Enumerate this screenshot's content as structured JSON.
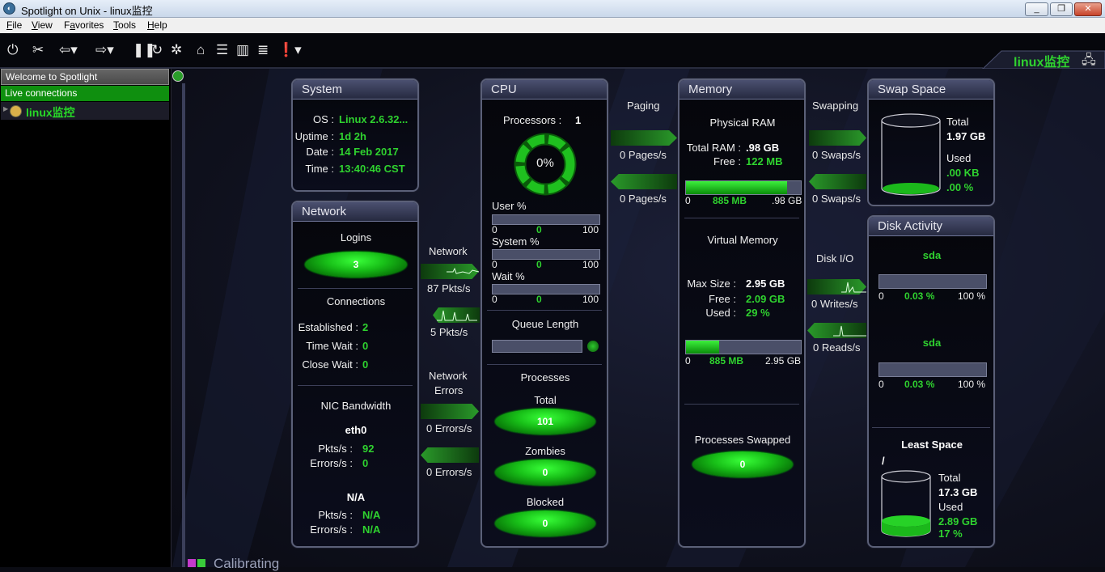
{
  "window": {
    "title": "Spotlight on Unix - linux监控",
    "min": "_",
    "max": "❐",
    "close": "✕"
  },
  "menu": [
    "File",
    "View",
    "Favorites",
    "Tools",
    "Help"
  ],
  "menu_access": [
    "F",
    "V",
    "a",
    "T",
    "H"
  ],
  "toolbar_icons": [
    "connect-icon",
    "disconnect-icon",
    "back-icon",
    "forward-icon",
    "pause-icon",
    "refresh-icon",
    "tools-icon",
    "home-icon",
    "list-icon",
    "chart-icon",
    "database-icon",
    "alarm-icon"
  ],
  "brand": {
    "connection_label": "linux监控"
  },
  "left": {
    "welcome": "Welcome to Spotlight",
    "live": "Live connections",
    "node": "linux监控"
  },
  "system": {
    "title": "System",
    "os_label": "OS :",
    "os": "Linux 2.6.32...",
    "uptime_label": "Uptime :",
    "uptime": "1d 2h",
    "date_label": "Date :",
    "date": "14 Feb 2017",
    "time_label": "Time :",
    "time": "13:40:46 CST"
  },
  "network": {
    "title": "Network",
    "logins_label": "Logins",
    "logins": "3",
    "connections_label": "Connections",
    "established_label": "Established :",
    "established": "2",
    "timewait_label": "Time  Wait :",
    "timewait": "0",
    "closewait_label": "Close  Wait :",
    "closewait": "0",
    "nic_label": "NIC Bandwidth",
    "nic1": {
      "name": "eth0",
      "pkts_label": "Pkts/s :",
      "pkts": "92",
      "errors_label": "Errors/s :",
      "errors": "0"
    },
    "nic2": {
      "name": "N/A",
      "pkts_label": "Pkts/s :",
      "pkts": "N/A",
      "errors_label": "Errors/s :",
      "errors": "N/A"
    }
  },
  "net_flow": {
    "label": "Network",
    "in": "87 Pkts/s",
    "out": "5 Pkts/s",
    "errors_label_1": "Network",
    "errors_label_2": "Errors",
    "err_in": "0 Errors/s",
    "err_out": "0 Errors/s"
  },
  "cpu": {
    "title": "CPU",
    "processors_label": "Processors :",
    "processors": "1",
    "usage": "0%",
    "usage_fraction": 0.0,
    "user_label": "User %",
    "user": "0",
    "user_min": "0",
    "user_max": "100",
    "system_label": "System %",
    "system": "0",
    "system_min": "0",
    "system_max": "100",
    "wait_label": "Wait %",
    "wait": "0",
    "wait_min": "0",
    "wait_max": "100",
    "queue_label": "Queue Length",
    "processes_label": "Processes",
    "total_label": "Total",
    "total": "101",
    "zombies_label": "Zombies",
    "zombies": "0",
    "blocked_label": "Blocked",
    "blocked": "0"
  },
  "paging": {
    "label": "Paging",
    "in": "0 Pages/s",
    "out": "0 Pages/s"
  },
  "memory": {
    "title": "Memory",
    "physical_label": "Physical RAM",
    "total_label": "Total RAM :",
    "total": ".98 GB",
    "free_label": "Free :",
    "free": "122 MB",
    "phys_used_fraction": 0.88,
    "phys_min": "0",
    "phys_used": "885 MB",
    "phys_max": ".98 GB",
    "virtual_label": "Virtual Memory",
    "max_label": "Max Size :",
    "max": "2.95 GB",
    "vfree_label": "Free :",
    "vfree": "2.09 GB",
    "used_label": "Used :",
    "used": "29 %",
    "virt_used_fraction": 0.29,
    "virt_min": "0",
    "virt_used": "885 MB",
    "virt_max": "2.95 GB",
    "swapped_label": "Processes Swapped",
    "swapped": "0"
  },
  "swapping": {
    "label": "Swapping",
    "in": "0 Swaps/s",
    "out": "0 Swaps/s"
  },
  "diskio": {
    "label": "Disk I/O",
    "writes": "0 Writes/s",
    "reads": "0 Reads/s"
  },
  "swap": {
    "title": "Swap Space",
    "total_label": "Total",
    "total": "1.97 GB",
    "used_label": "Used",
    "used": ".00 KB",
    "used_pct": ".00 %"
  },
  "disk": {
    "title": "Disk Activity",
    "d1": {
      "name": "sda",
      "min": "0",
      "value": "0.03 %",
      "max": "100 %"
    },
    "d2": {
      "name": "sda",
      "min": "0",
      "value": "0.03 %",
      "max": "100 %"
    },
    "least_label": "Least Space",
    "mount": "/",
    "total_label": "Total",
    "total": "17.3 GB",
    "used_label": "Used",
    "used": "2.89 GB",
    "used_pct": "17 %",
    "used_fraction": 0.17
  },
  "status": {
    "text": "Calibrating"
  },
  "colors": {
    "accent_green": "#2fd22f",
    "panel_border": "#5b6078",
    "background": "#10121f"
  }
}
